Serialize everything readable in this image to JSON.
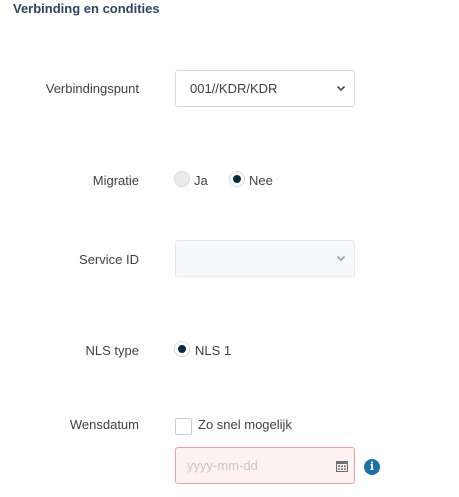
{
  "section": {
    "title": "Verbinding en condities"
  },
  "verbindingspunt": {
    "label": "Verbindingspunt",
    "value": "001//KDR/KDR"
  },
  "migratie": {
    "label": "Migratie",
    "options": [
      {
        "label": "Ja",
        "selected": false
      },
      {
        "label": "Nee",
        "selected": true
      }
    ]
  },
  "service_id": {
    "label": "Service ID",
    "value": ""
  },
  "nls_type": {
    "label": "NLS type",
    "options": [
      {
        "label": "NLS 1",
        "selected": true
      }
    ]
  },
  "wensdatum": {
    "label": "Wensdatum",
    "checkbox_label": "Zo snel mogelijk",
    "checked": false,
    "placeholder": "yyyy-mm-dd",
    "value": ""
  },
  "colors": {
    "title": "#2c4560",
    "radio_selected": "#0c2a3e",
    "error_border": "#e9a3a3",
    "error_bg": "#fdf1f1",
    "info": "#1f6fa8"
  },
  "icons": {
    "select_chevron": "chevron-down-icon",
    "calendar": "calendar-icon",
    "info": "info-icon"
  }
}
